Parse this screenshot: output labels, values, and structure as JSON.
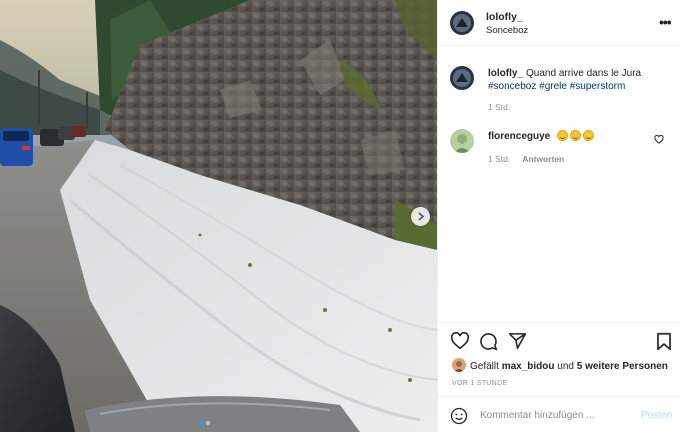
{
  "post": {
    "username": "lolofly_",
    "location": "Sonceboz",
    "more_label": "•••",
    "caption_username": "lolofly_",
    "caption_text": "Quand arrive dans le Jura",
    "hashtags": [
      "#sonceboz",
      "#grele",
      "#superstorm"
    ],
    "caption_time": "1 Std."
  },
  "comments": [
    {
      "username": "florenceguye",
      "emojis": [
        "grinning-face",
        "grinning-face",
        "grinning-face"
      ],
      "time": "1 Std.",
      "reply_label": "Antworten"
    }
  ],
  "likes": {
    "prefix": "Gefällt ",
    "user": "max_bidou",
    "middle": " und ",
    "others": "5 weitere Personen"
  },
  "post_time": "VOR 1 STUNDE",
  "comment_box": {
    "placeholder": "Kommentar hinzufügen ...",
    "post_label": "Posten"
  },
  "carousel": {
    "slide_count": 2,
    "active_index": 0
  },
  "colors": {
    "link": "#00376b",
    "accent": "#3897f0",
    "post_disabled": "#b2dffc",
    "meta": "#8e8e8e"
  }
}
